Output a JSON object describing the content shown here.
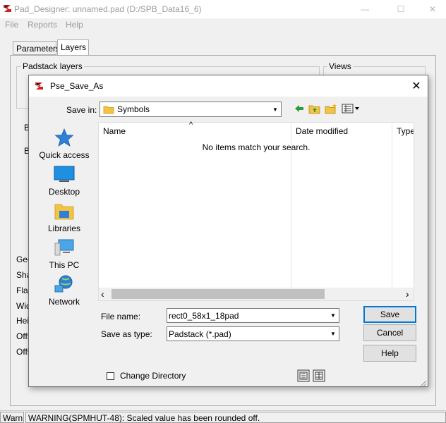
{
  "app": {
    "title": "Pad_Designer: unnamed.pad (D:/SPB_Data16_6)",
    "window_controls": [
      "—",
      "☐",
      "✕"
    ],
    "menu": [
      "File",
      "Reports",
      "Help"
    ],
    "tabs": [
      "Parameters",
      "Layers"
    ],
    "active_tab": "Layers",
    "groups": {
      "padstack_layers": "Padstack layers",
      "views": "Views"
    },
    "background_labels": [
      "B",
      "B",
      "Geo",
      "Sha",
      "Flas",
      "Wid",
      "Hei",
      "Offs",
      "Offs"
    ]
  },
  "status": {
    "left": "Warn",
    "message": "WARNING(SPMHUT-48): Scaled value has been rounded off."
  },
  "dialog": {
    "title": "Pse_Save_As",
    "close_glyph": "✕",
    "save_in_label": "Save in:",
    "save_in_value": "Symbols",
    "places": [
      "Quick access",
      "Desktop",
      "Libraries",
      "This PC",
      "Network"
    ],
    "columns": [
      "Name",
      "Date modified",
      "Type"
    ],
    "empty_message": "No items match your search.",
    "file_name_label": "File name:",
    "file_name_value": "rect0_58x1_18pad",
    "save_type_label": "Save as type:",
    "save_type_value": "Padstack (*.pad)",
    "buttons": {
      "save": "Save",
      "cancel": "Cancel",
      "help": "Help"
    },
    "change_directory_label": "Change Directory",
    "scroll_left": "‹",
    "scroll_right": "›",
    "sort_glyph": "^"
  },
  "colors": {
    "accent": "#0078d7",
    "folder": "#f5c342",
    "app_icon_red": "#d32020"
  }
}
